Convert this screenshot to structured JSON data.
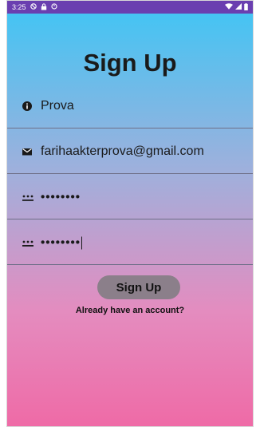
{
  "status_bar": {
    "time": "3:25",
    "left_icons": [
      "do-not-disturb-icon",
      "lock-icon",
      "sync-icon"
    ],
    "right_icons": [
      "wifi-icon",
      "signal-icon",
      "battery-icon"
    ]
  },
  "page": {
    "title": "Sign Up"
  },
  "form": {
    "name_value": "Prova",
    "email_value": "farihaakterprova@gmail.com",
    "password_value": "••••••••",
    "confirm_password_value": "••••••••",
    "submit_label": "Sign Up",
    "login_link": "Already have an account?"
  },
  "colors": {
    "status_bar": "#6a3fb0",
    "gradient_top": "#45c4f3",
    "gradient_bottom": "#ef6aa6",
    "button_bg": "#8b7f8a"
  }
}
